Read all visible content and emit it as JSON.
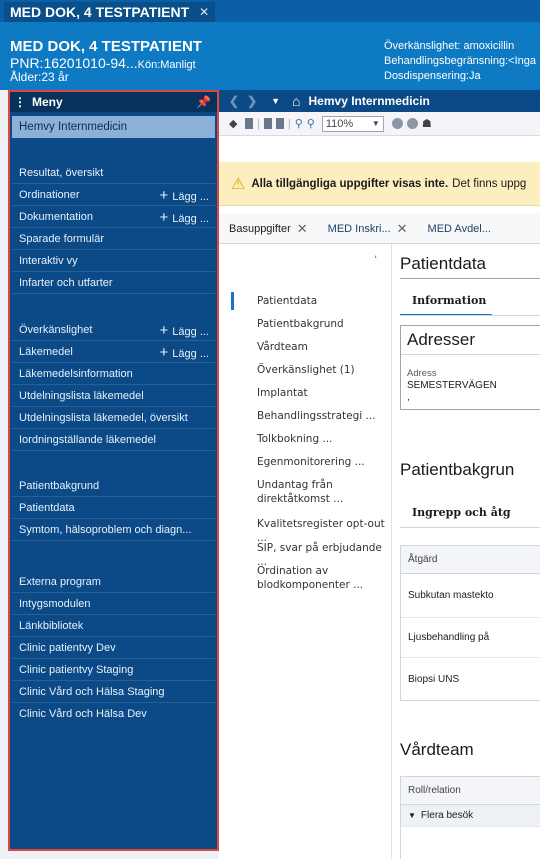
{
  "patient": {
    "tab_label": "MED DOK, 4 TESTPATIENT",
    "name": "MED DOK, 4 TESTPATIENT",
    "pnr": "PNR:16201010-94...",
    "gender": "Kön:Manligt",
    "age": "Ålder:23 år",
    "allergy": "Överkänslighet: amoxicillin",
    "restriction": "Behandlingsbegränsning:<Inga",
    "dose_dispensing": "Dosdispensering:Ja"
  },
  "sidebar": {
    "header": "Meny",
    "add_label": "Lägg ...",
    "items": [
      {
        "label": "Hemvy Internmedicin"
      },
      {
        "label": "Resultat, översikt"
      },
      {
        "label": "Ordinationer"
      },
      {
        "label": "Dokumentation"
      },
      {
        "label": "Sparade formulär"
      },
      {
        "label": "Interaktiv vy"
      },
      {
        "label": "Infarter och utfarter"
      },
      {
        "label": "Överkänslighet"
      },
      {
        "label": "Läkemedel"
      },
      {
        "label": "Läkemedelsinformation"
      },
      {
        "label": "Utdelningslista läkemedel"
      },
      {
        "label": "Utdelningslista läkemedel, översikt"
      },
      {
        "label": "Iordningställande läkemedel"
      },
      {
        "label": "Patientbakgrund"
      },
      {
        "label": "Patientdata"
      },
      {
        "label": "Symtom, hälsoproblem och diagn..."
      },
      {
        "label": "Externa program"
      },
      {
        "label": "Intygsmodulen"
      },
      {
        "label": "Länkbibliotek"
      },
      {
        "label": "Clinic patientvy Dev"
      },
      {
        "label": "Clinic patientvy Staging"
      },
      {
        "label": "Clinic Vård och Hälsa Staging"
      },
      {
        "label": "Clinic Vård och Hälsa Dev"
      }
    ]
  },
  "navbar": {
    "title": "Hemvy Internmedicin"
  },
  "toolbar": {
    "zoom": "110%"
  },
  "alert": {
    "bold": "Alla tillgängliga uppgifter visas inte.",
    "text": "Det finns uppg"
  },
  "tabs": [
    {
      "label": "Basuppgifter"
    },
    {
      "label": "MED Inskri..."
    },
    {
      "label": "MED Avdel..."
    }
  ],
  "subnav": [
    {
      "label": "Patientdata"
    },
    {
      "label": "Patientbakgrund"
    },
    {
      "label": "Vårdteam"
    },
    {
      "label": "Överkänslighet (1)"
    },
    {
      "label": "Implantat"
    },
    {
      "label": "Behandlingsstrategi ..."
    },
    {
      "label": "Tolkbokning ..."
    },
    {
      "label": "Egenmonitorering ..."
    },
    {
      "label": "Undantag från direktåtkomst ..."
    },
    {
      "label": "Kvalitetsregister opt-out ..."
    },
    {
      "label": "SIP, svar på erbjudande ..."
    },
    {
      "label": "Ordination av blodkomponenter ..."
    }
  ],
  "content": {
    "patientdata_title": "Patientdata",
    "info_tab": "Information",
    "address_card_title": "Adresser",
    "address_label": "Adress",
    "address_value": "SEMESTERVÄGEN",
    "address_line2": ",",
    "patientbakgrund_title": "Patientbakgrun",
    "ingrepp_tab": "Ingrepp och åtg",
    "procedure_header": "Åtgärd",
    "procedures": [
      {
        "label": "Subkutan mastekto"
      },
      {
        "label": "Ljusbehandling på"
      },
      {
        "label": "Biopsi UNS"
      }
    ],
    "vardteam_title": "Vårdteam",
    "role_header": "Roll/relation",
    "group_row": "Flera besök"
  }
}
